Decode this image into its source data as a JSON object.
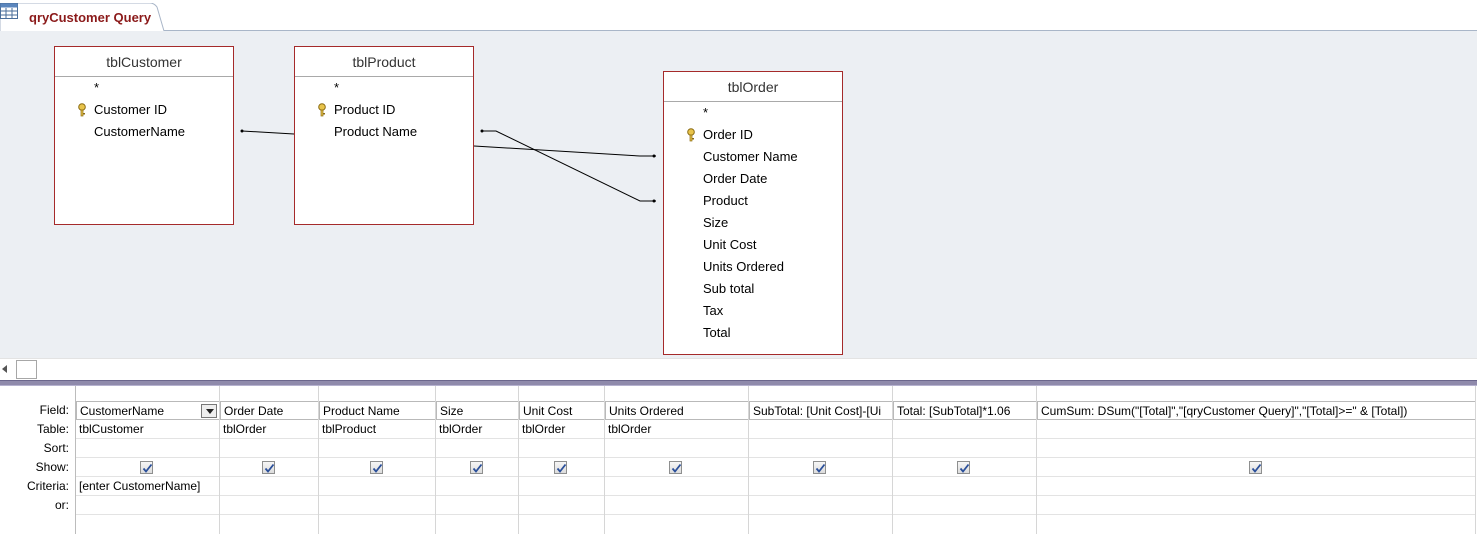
{
  "tab": {
    "title": "qryCustomer Query",
    "icon": "query-icon"
  },
  "tables": [
    {
      "name": "tblCustomer",
      "fields": [
        "*",
        "Customer ID",
        "CustomerName"
      ],
      "key_field": "Customer ID"
    },
    {
      "name": "tblProduct",
      "fields": [
        "*",
        "Product ID",
        "Product Name"
      ],
      "key_field": "Product ID"
    },
    {
      "name": "tblOrder",
      "fields": [
        "*",
        "Order ID",
        "Customer Name",
        "Order Date",
        "Product",
        "Size",
        "Unit Cost",
        "Units Ordered",
        "Sub total",
        "Tax",
        "Total"
      ],
      "key_field": "Order ID"
    }
  ],
  "grid": {
    "row_labels": {
      "field": "Field:",
      "table": "Table:",
      "sort": "Sort:",
      "show": "Show:",
      "criteria": "Criteria:",
      "or": "or:"
    },
    "columns": [
      {
        "field": "CustomerName",
        "table": "tblCustomer",
        "sort": "",
        "show": true,
        "criteria": "[enter CustomerName]",
        "or": ""
      },
      {
        "field": "Order Date",
        "table": "tblOrder",
        "sort": "",
        "show": true,
        "criteria": "",
        "or": ""
      },
      {
        "field": "Product Name",
        "table": "tblProduct",
        "sort": "",
        "show": true,
        "criteria": "",
        "or": ""
      },
      {
        "field": "Size",
        "table": "tblOrder",
        "sort": "",
        "show": true,
        "criteria": "",
        "or": ""
      },
      {
        "field": "Unit Cost",
        "table": "tblOrder",
        "sort": "",
        "show": true,
        "criteria": "",
        "or": ""
      },
      {
        "field": "Units Ordered",
        "table": "tblOrder",
        "sort": "",
        "show": true,
        "criteria": "",
        "or": ""
      },
      {
        "field": "SubTotal: [Unit Cost]-[Ui",
        "table": "",
        "sort": "",
        "show": true,
        "criteria": "",
        "or": ""
      },
      {
        "field": "Total: [SubTotal]*1.06",
        "table": "",
        "sort": "",
        "show": true,
        "criteria": "",
        "or": ""
      },
      {
        "field": "CumSum: DSum(\"[Total]\",\"[qryCustomer Query]\",\"[Total]>=\" & [Total])",
        "table": "",
        "sort": "",
        "show": true,
        "criteria": "",
        "or": ""
      }
    ]
  }
}
